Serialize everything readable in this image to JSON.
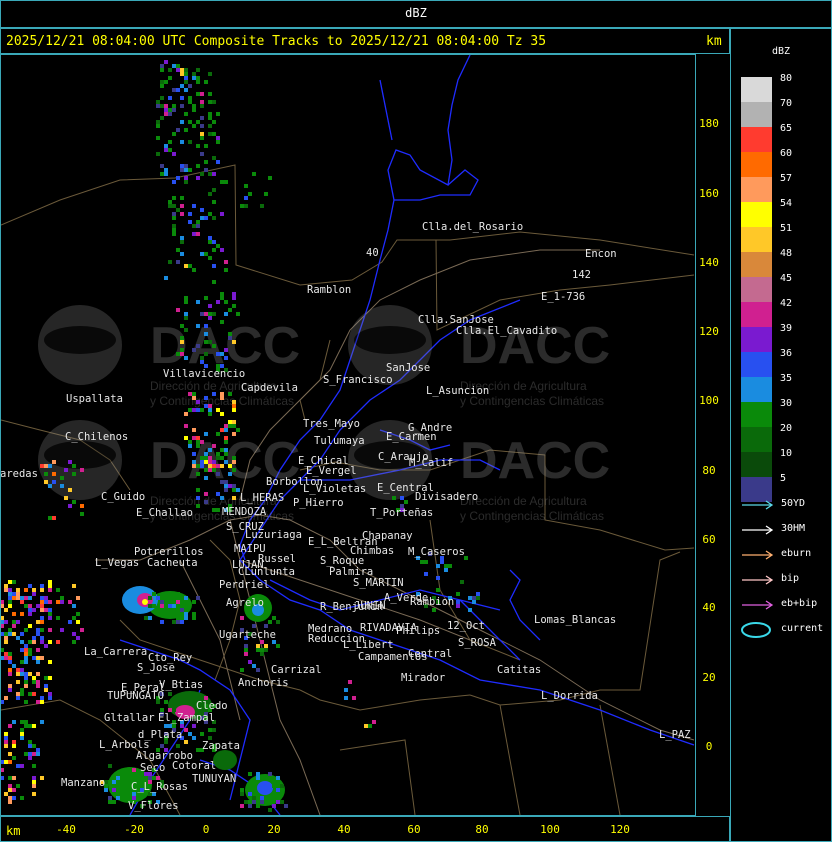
{
  "window": {
    "title": "dBZ"
  },
  "header": {
    "text": "2025/12/21 08:04:00 UTC Composite Tracks to 2025/12/21 08:04:00 Tz 35",
    "km_label": "km"
  },
  "bottom": {
    "km_label": "km"
  },
  "axes": {
    "x_ticks": [
      "-40",
      "-20",
      "0",
      "20",
      "40",
      "60",
      "80",
      "100",
      "120"
    ],
    "y_ticks": [
      "180",
      "160",
      "140",
      "120",
      "100",
      "80",
      "60",
      "40",
      "20",
      "0"
    ]
  },
  "legend": {
    "title": "dBZ",
    "levels": [
      {
        "label": "80",
        "color": "#d9d9d9"
      },
      {
        "label": "70",
        "color": "#b2b2b2"
      },
      {
        "label": "65",
        "color": "#ff3b2f"
      },
      {
        "label": "60",
        "color": "#ff6a00"
      },
      {
        "label": "57",
        "color": "#ff9a5c"
      },
      {
        "label": "54",
        "color": "#ffff00"
      },
      {
        "label": "51",
        "color": "#ffc828"
      },
      {
        "label": "48",
        "color": "#d9883a"
      },
      {
        "label": "45",
        "color": "#c46a90"
      },
      {
        "label": "42",
        "color": "#d02090"
      },
      {
        "label": "39",
        "color": "#7a1ad0"
      },
      {
        "label": "36",
        "color": "#2850f0"
      },
      {
        "label": "35",
        "color": "#1a8ce0"
      },
      {
        "label": "30",
        "color": "#0a8a0a"
      },
      {
        "label": "20",
        "color": "#0a6a0a"
      },
      {
        "label": "10",
        "color": "#0a4a0a"
      },
      {
        "label": "5",
        "color": "#3a3a8a"
      }
    ],
    "tracks": [
      {
        "label": "50YD",
        "color": "#5ad8e8"
      },
      {
        "label": "30HM",
        "color": "#ffffff"
      },
      {
        "label": "eburn",
        "color": "#ffb070"
      },
      {
        "label": "bip",
        "color": "#ffc8c8"
      },
      {
        "label": "eb+bip",
        "color": "#e060e0"
      },
      {
        "label": "current",
        "color": "#3ad8e8"
      }
    ]
  },
  "watermark": {
    "brand": "DACC",
    "line1": "Dirección de Agricultura",
    "line2": "y Contingencias Climáticas"
  },
  "places": [
    "Clla.del_Rosario",
    "Encon",
    "142",
    "E_1-736",
    "Ramblon",
    "40",
    "Clla.SanJose",
    "Clla.El_Cavadito",
    "Villavicencio",
    "Capdevila",
    "S_Francisco",
    "SanJose",
    "L_Asuncion",
    "Uspallata",
    "Tres_Mayo",
    "Tulumaya",
    "E_Carmen",
    "G_Andre",
    "C_Chilenos",
    "E_Chical",
    "E_Vergel",
    "C_Araujo",
    "M_Calif",
    "aredas",
    "Borbollon",
    "L_Violetas",
    "E_Central",
    "Divisadero",
    "C_Guido",
    "L_HERAS",
    "P_Hierro",
    "E_Challao",
    "MENDOZA",
    "T_Porteñas",
    "S_CRUZ",
    "Luzuriaga",
    "Chapanay",
    "E_L_Beltran",
    "Chimbas",
    "M_Caseros",
    "MAIPU",
    "Potrerillos",
    "Russel",
    "L_Vegas",
    "Cacheuta",
    "LUJAN",
    "S_Roque",
    "Palmira",
    "CLunlunta",
    "Perdriel",
    "S_MARTIN",
    "A_Verde",
    "Rambion",
    "Agrelo",
    "R_Benjunin",
    "JUNIN",
    "Ugarteche",
    "Medrano",
    "RIVADAVIA",
    "Philips",
    "12_Oct",
    "Lomas_Blancas",
    "Reduccion",
    "L_Libert",
    "S_ROSA",
    "La_Carrera",
    "Cto_Rey",
    "S_Jose",
    "Campamentos",
    "Central",
    "Carrizal",
    "Catitas",
    "Anchoris",
    "Mirador",
    "V_Btias",
    "E_Peral",
    "TUPUNGATO",
    "L_Dorrida",
    "Gltallar",
    "El_Zampal",
    "Cledo",
    "d_Plata",
    "L_Arbols",
    "L_PAZ",
    "Zapata",
    "Algarrobo",
    "Seco",
    "Cotoral",
    "TUNUYAN",
    "Manzano",
    "C_L_Rosas",
    "V_Flores"
  ]
}
